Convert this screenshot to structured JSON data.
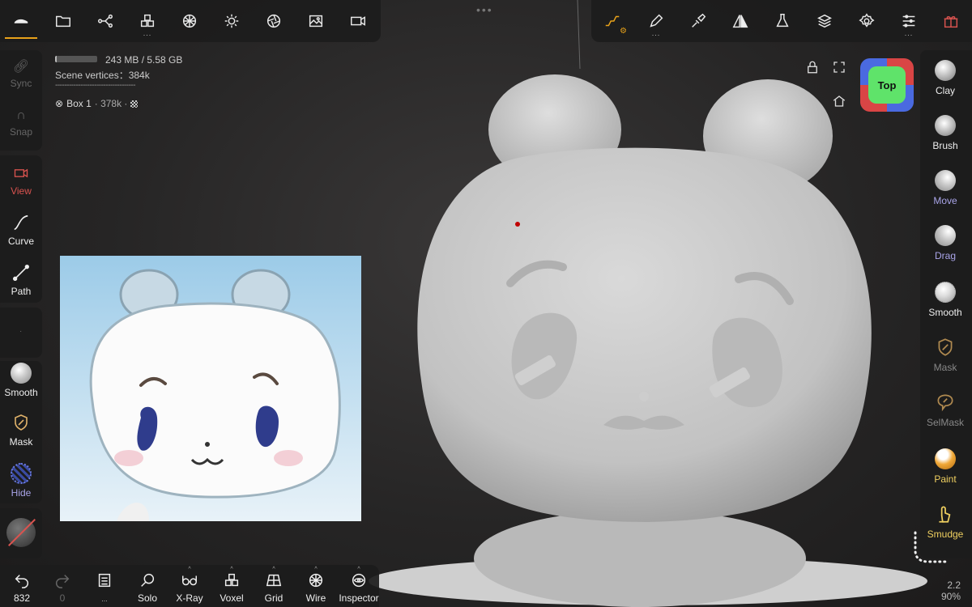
{
  "stats": {
    "memory": "243 MB / 5.58 GB",
    "memory_fraction": 0.044,
    "vertices": "Scene vertices：384k",
    "divider": "-----------------------------------",
    "object_name": "Box 1",
    "object_meta": "· 378k ·"
  },
  "gizmo": {
    "label": "Top"
  },
  "left_tools": {
    "sync": "Sync",
    "snap": "Snap",
    "view": "View",
    "curve": "Curve",
    "path": "Path",
    "smooth": "Smooth",
    "mask": "Mask",
    "hide": "Hide"
  },
  "right_tools": {
    "clay": "Clay",
    "brush": "Brush",
    "move": "Move",
    "drag": "Drag",
    "smooth": "Smooth",
    "mask": "Mask",
    "selmask": "SelMask",
    "paint": "Paint",
    "smudge": "Smudge"
  },
  "bottom": {
    "undo_count": "832",
    "redo_count": "0",
    "solo": "Solo",
    "xray": "X-Ray",
    "voxel": "Voxel",
    "grid": "Grid",
    "wire": "Wire",
    "inspector": "Inspector"
  },
  "corner": {
    "value": "2.2",
    "zoom": "90%"
  },
  "colors": {
    "accent_orange": "#e8a21a",
    "active_purple": "#a9a4e8",
    "inactive_red": "#d9534f",
    "highlight_yellow": "#f0d060",
    "gizmo_green": "#5fe36a"
  }
}
